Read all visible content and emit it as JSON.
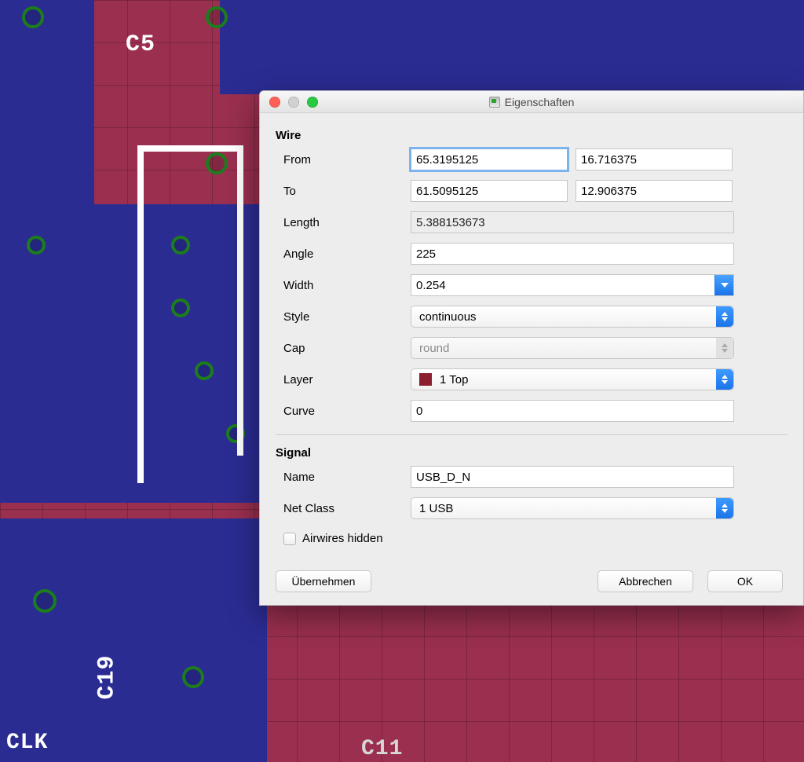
{
  "title": "Eigenschaften",
  "sections": {
    "wire": {
      "title": "Wire",
      "from_label": "From",
      "from_x": "65.3195125",
      "from_y": "16.716375",
      "to_label": "To",
      "to_x": "61.5095125",
      "to_y": "12.906375",
      "length_label": "Length",
      "length": "5.388153673",
      "angle_label": "Angle",
      "angle": "225",
      "width_label": "Width",
      "width": "0.254",
      "style_label": "Style",
      "style": "continuous",
      "cap_label": "Cap",
      "cap": "round",
      "layer_label": "Layer",
      "layer": "1 Top",
      "layer_color": "#8c1f2f",
      "curve_label": "Curve",
      "curve": "0"
    },
    "signal": {
      "title": "Signal",
      "name_label": "Name",
      "name": "USB_D_N",
      "netclass_label": "Net Class",
      "netclass": "1 USB",
      "airwires_label": "Airwires hidden",
      "airwires_checked": false
    }
  },
  "buttons": {
    "apply": "Übernehmen",
    "cancel": "Abbrechen",
    "ok": "OK"
  },
  "background": {
    "silk_labels": [
      "C5",
      "C19",
      "CLK",
      "C11"
    ]
  }
}
